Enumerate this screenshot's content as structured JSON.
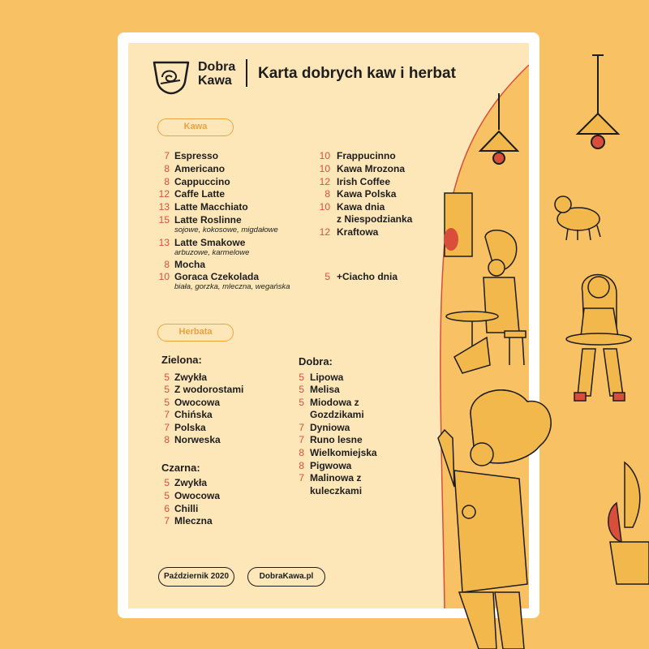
{
  "brand": {
    "line1": "Dobra",
    "line2": "Kawa"
  },
  "title": "Karta dobrych kaw i herbat",
  "sections": {
    "coffee_label": "Kawa",
    "tea_label": "Herbata"
  },
  "coffee_left": [
    {
      "price": "7",
      "name": "Espresso"
    },
    {
      "price": "8",
      "name": "Americano"
    },
    {
      "price": "8",
      "name": "Cappuccino"
    },
    {
      "price": "12",
      "name": "Caffe Latte"
    },
    {
      "price": "13",
      "name": "Latte Macchiato"
    },
    {
      "price": "15",
      "name": "Latte Roslinne",
      "note": "sojowe, kokosowe, migdałowe"
    },
    {
      "price": "13",
      "name": "Latte Smakowe",
      "note": "arbuzowe, karmelowe"
    },
    {
      "price": "8",
      "name": "Mocha"
    },
    {
      "price": "10",
      "name": "Goraca Czekolada",
      "note": "biała, gorzka, mleczna, wegańska"
    }
  ],
  "coffee_right": [
    {
      "price": "10",
      "name": "Frappucinno"
    },
    {
      "price": "10",
      "name": "Kawa Mrozona"
    },
    {
      "price": "12",
      "name": "Irish Coffee"
    },
    {
      "price": "8",
      "name": "Kawa Polska"
    },
    {
      "price": "10",
      "name": "Kawa dnia",
      "name2": "z Niespodzianka"
    },
    {
      "price": "12",
      "name": "Kraftowa"
    }
  ],
  "extra": {
    "price": "5",
    "name": "+Ciacho dnia"
  },
  "tea_green": {
    "heading": "Zielona:",
    "items": [
      {
        "price": "5",
        "name": "Zwykła"
      },
      {
        "price": "5",
        "name": "Z wodorostami"
      },
      {
        "price": "5",
        "name": "Owocowa"
      },
      {
        "price": "7",
        "name": "Chińska"
      },
      {
        "price": "7",
        "name": "Polska"
      },
      {
        "price": "8",
        "name": "Norweska"
      }
    ]
  },
  "tea_black": {
    "heading": "Czarna:",
    "items": [
      {
        "price": "5",
        "name": "Zwykła"
      },
      {
        "price": "5",
        "name": "Owocowa"
      },
      {
        "price": "6",
        "name": "Chilli"
      },
      {
        "price": "7",
        "name": "Mleczna"
      }
    ]
  },
  "tea_good": {
    "heading": "Dobra:",
    "items": [
      {
        "price": "5",
        "name": "Lipowa"
      },
      {
        "price": "5",
        "name": "Melisa"
      },
      {
        "price": "5",
        "name": "Miodowa z",
        "name2": "Gozdzikami"
      },
      {
        "price": "7",
        "name": "Dyniowa"
      },
      {
        "price": "7",
        "name": "Runo lesne"
      },
      {
        "price": "8",
        "name": "Wielkomiejska"
      },
      {
        "price": "8",
        "name": "Pigwowa"
      },
      {
        "price": "7",
        "name": "Malinowa z",
        "name2": "kuleczkami"
      }
    ]
  },
  "footer": {
    "date": "Październik 2020",
    "url": "DobraKawa.pl"
  },
  "colors": {
    "background": "#F8C163",
    "paper": "#FDE7B8",
    "price": "#D94E3A",
    "accent": "#EFA23E",
    "illustration": "#F2B84B",
    "ink": "#1d1d1d"
  },
  "icons": [
    "coffee-cup-logo-icon"
  ]
}
